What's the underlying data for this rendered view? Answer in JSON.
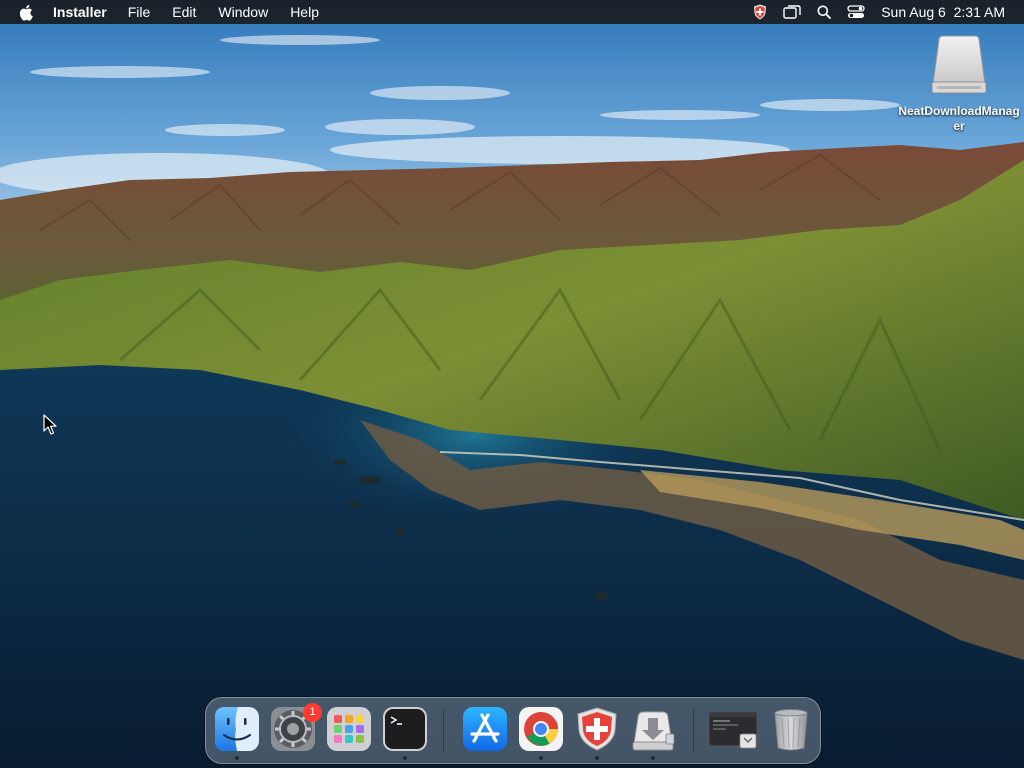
{
  "menubar": {
    "app_name": "Installer",
    "menus": [
      "File",
      "Edit",
      "Window",
      "Help"
    ],
    "status_icons": [
      "shield-icon",
      "screen-mirroring-icon",
      "search-icon",
      "control-center-icon"
    ],
    "clock_date": "Sun Aug 6",
    "clock_time": "2:31 AM"
  },
  "desktop": {
    "drive_label": "NeatDownloadManager"
  },
  "dock": {
    "items": [
      {
        "name": "Finder",
        "icon": "finder-icon",
        "running": true
      },
      {
        "name": "System Preferences",
        "icon": "system-preferences-icon",
        "running": false,
        "badge": "1"
      },
      {
        "name": "Launchpad",
        "icon": "launchpad-icon",
        "running": false
      },
      {
        "name": "Terminal",
        "icon": "terminal-icon",
        "running": true
      },
      {
        "name": "App Store",
        "icon": "app-store-icon",
        "running": false
      },
      {
        "name": "Google Chrome",
        "icon": "chrome-icon",
        "running": true
      },
      {
        "name": "Security App",
        "icon": "shield-app-icon",
        "running": true
      },
      {
        "name": "Installer",
        "icon": "installer-icon",
        "running": true
      },
      {
        "name": "Terminal Window",
        "icon": "minimized-window-icon",
        "running": false
      },
      {
        "name": "Trash",
        "icon": "trash-icon",
        "running": false
      }
    ]
  },
  "colors": {
    "menubar_bg": "#1b1e22",
    "badge_red": "#ff3b30",
    "sea": "#0f3a5a",
    "sky": "#3f86c8"
  }
}
